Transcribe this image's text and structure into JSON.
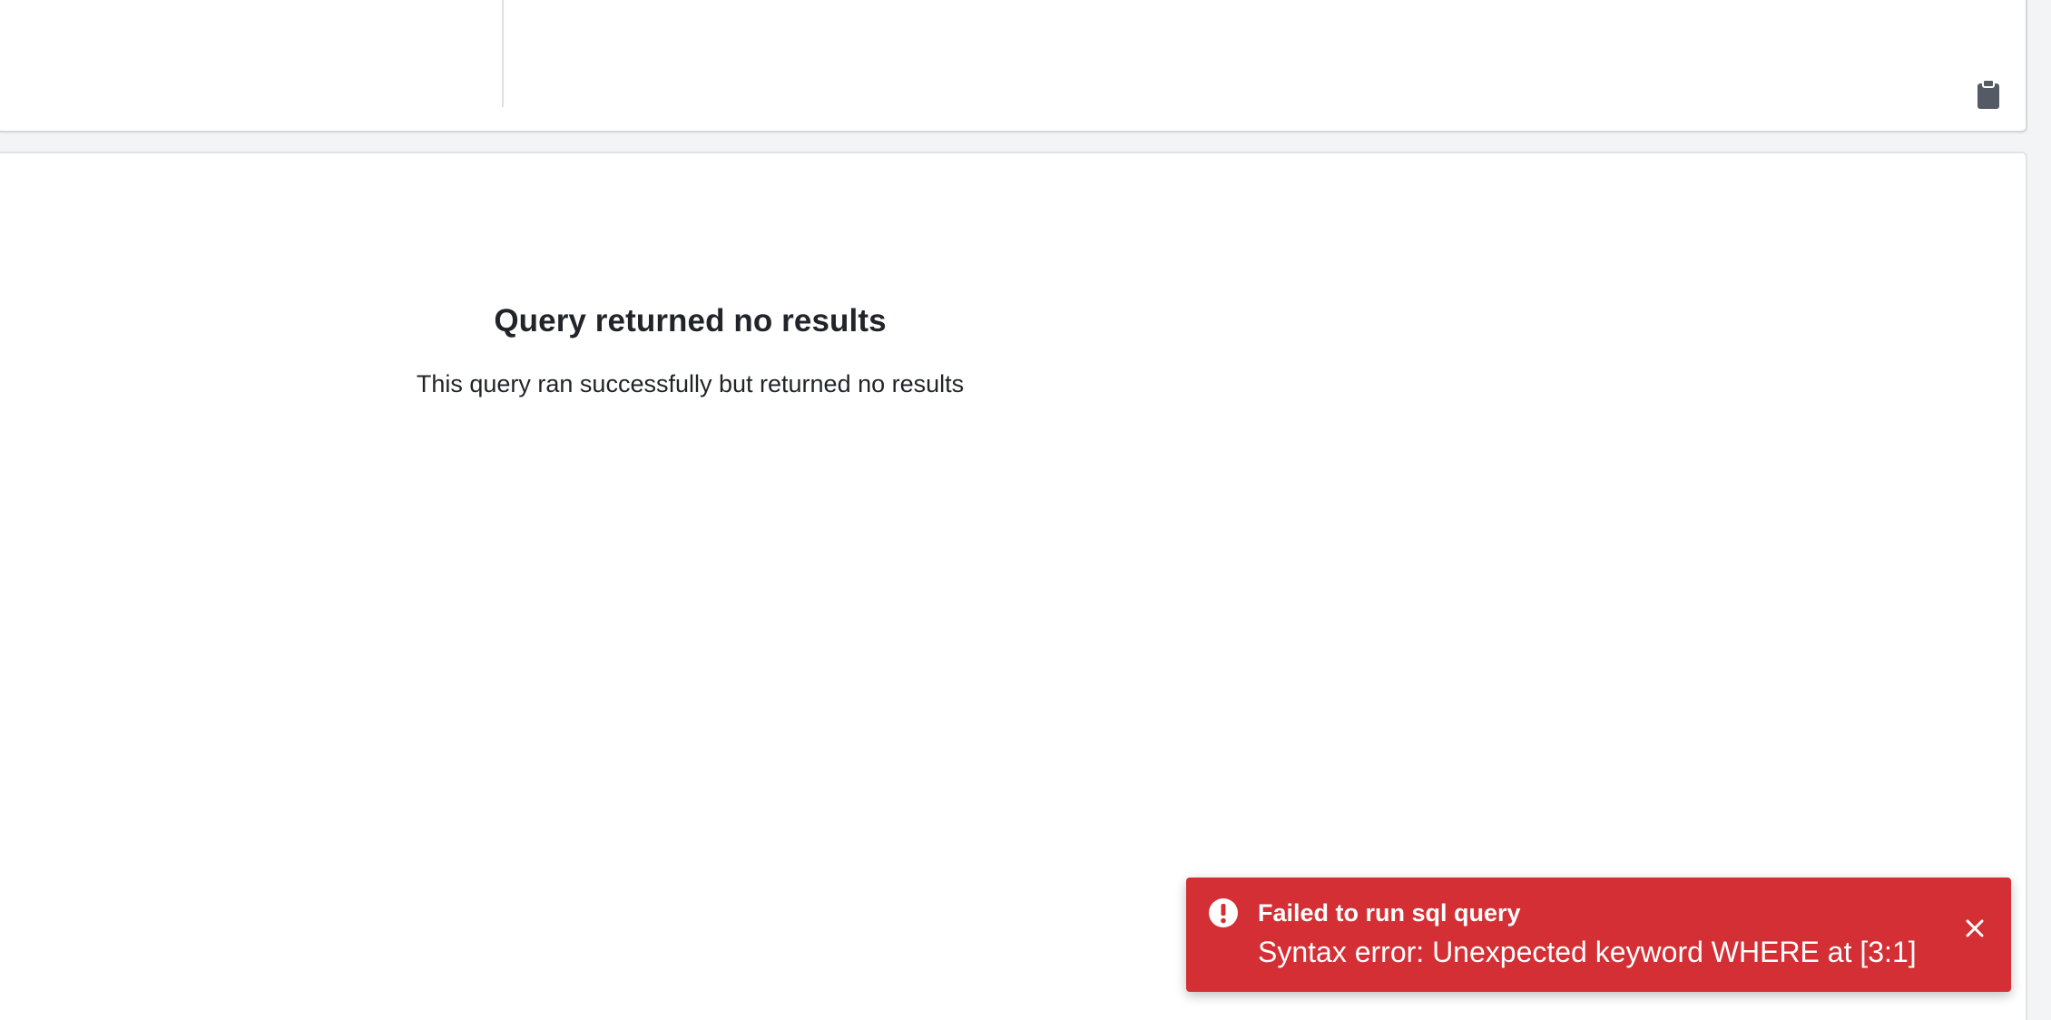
{
  "editor": {
    "copy_icon": "clipboard-icon",
    "copy_icon_color": "#545b64"
  },
  "results": {
    "empty_title": "Query returned no results",
    "empty_description": "This query ran successfully but returned no results"
  },
  "toast": {
    "status": "error",
    "background_color": "#d32f34",
    "icon": "exclamation-circle-icon",
    "title": "Failed to run sql query",
    "message": "Syntax error: Unexpected keyword WHERE at [3:1]",
    "close_icon": "close-icon"
  }
}
